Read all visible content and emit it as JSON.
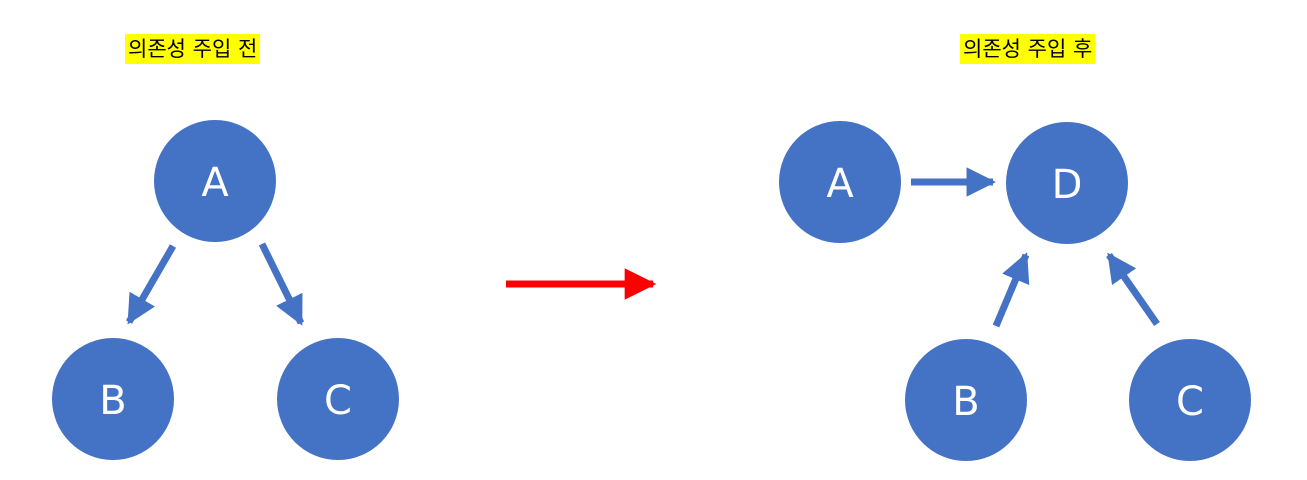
{
  "before": {
    "caption": "의존성 주입 전",
    "nodes": {
      "a": "A",
      "b": "B",
      "c": "C"
    }
  },
  "after": {
    "caption": "의존성 주입 후",
    "nodes": {
      "a": "A",
      "b": "B",
      "c": "C",
      "d": "D"
    }
  },
  "colors": {
    "node_fill": "#4472C4",
    "edge": "#4472C4",
    "transition_arrow": "#FF0000",
    "caption_highlight": "#FFFF00",
    "label_text": "#FFFFFF"
  }
}
